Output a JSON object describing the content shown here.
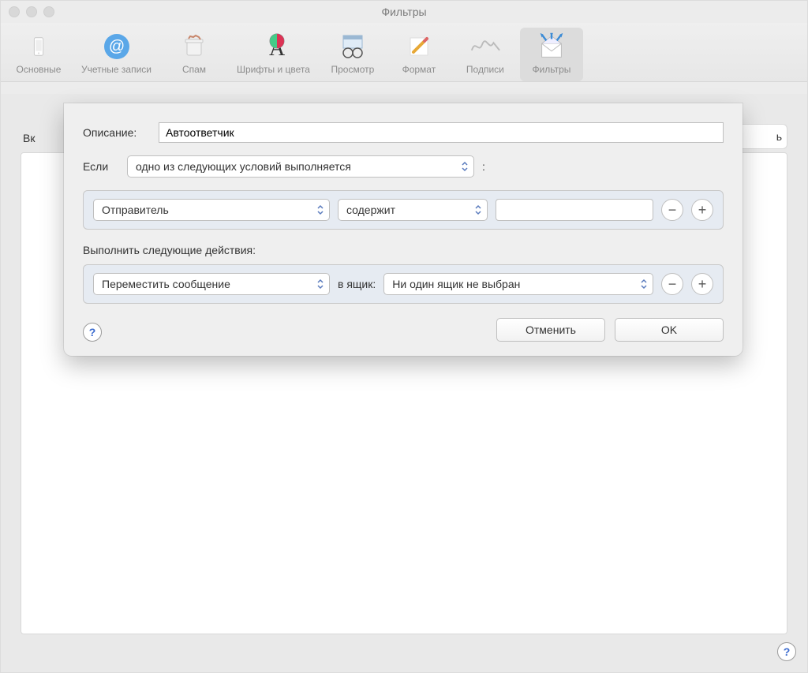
{
  "window_title": "Фильтры",
  "toolbar": {
    "items": [
      {
        "label": "Основные"
      },
      {
        "label": "Учетные записи"
      },
      {
        "label": "Спам"
      },
      {
        "label": "Шрифты и цвета"
      },
      {
        "label": "Просмотр"
      },
      {
        "label": "Формат"
      },
      {
        "label": "Подписи"
      },
      {
        "label": "Фильтры"
      }
    ]
  },
  "background": {
    "left_header": "Вк",
    "right_peek": "ть"
  },
  "sheet": {
    "description_label": "Описание:",
    "description_value": "Автоответчик",
    "if_label": "Если",
    "condition_mode": "одно из следующих условий выполняется",
    "colon": ":",
    "condition_field": "Отправитель",
    "condition_op": "содержит",
    "condition_value": "",
    "actions_label": "Выполнить следующие действия:",
    "action_name": "Переместить сообщение",
    "mailbox_label": "в ящик:",
    "mailbox_value": "Ни один ящик не выбран",
    "cancel": "Отменить",
    "ok": "OK",
    "help": "?"
  }
}
